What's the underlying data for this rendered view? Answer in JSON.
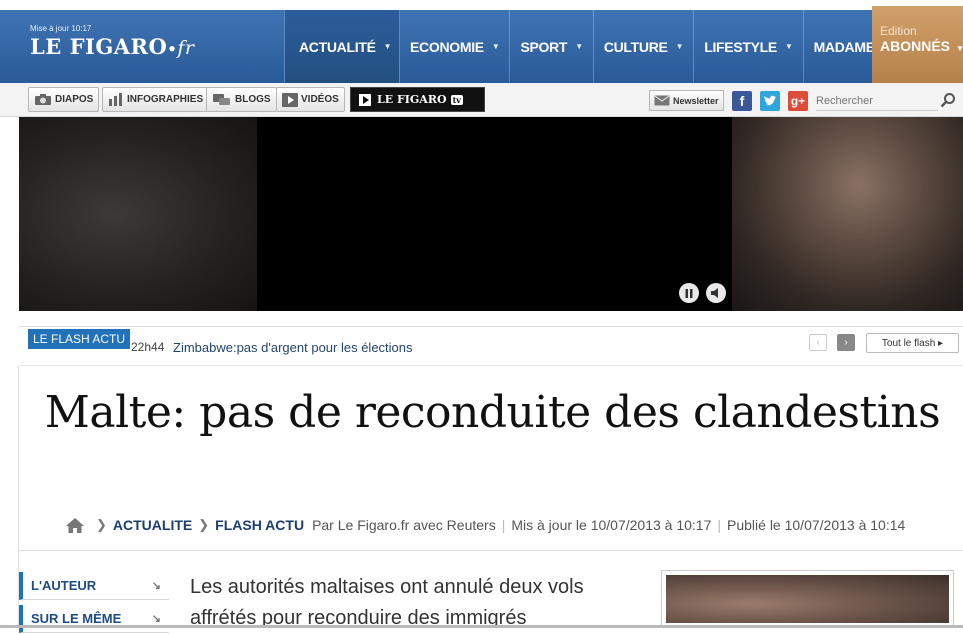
{
  "header": {
    "updated": "Mise à jour 10:17",
    "logo_main": "LE FIGARO",
    "logo_dot": "•",
    "logo_suffix": "fr",
    "nav": [
      {
        "label": "ACTUALITÉ"
      },
      {
        "label": "ECONOMIE"
      },
      {
        "label": "SPORT"
      },
      {
        "label": "CULTURE"
      },
      {
        "label": "LIFESTYLE"
      },
      {
        "label": "MADAME"
      }
    ],
    "edition": {
      "line1": "Edition",
      "line2": "ABONNÉS"
    }
  },
  "toolbar": {
    "diapos": "DIAPOS",
    "infographies": "INFOGRAPHIES",
    "blogs": "BLOGS",
    "videos": "VIDÉOS",
    "figaro_tv": "LE FIGARO",
    "tv_badge": "tv",
    "newsletter": "Newsletter",
    "search_placeholder": "Rechercher"
  },
  "flash": {
    "label": "LE FLASH ACTU",
    "time": "22h44",
    "text": "Zimbabwe:pas d'argent pour les élections",
    "all_link": "Tout le flash ▸"
  },
  "article": {
    "title": "Malte: pas de reconduite des clandestins",
    "breadcrumb": [
      "ACTUALITE",
      "FLASH ACTU"
    ],
    "author": "Par Le Figaro.fr avec Reuters",
    "updated": "Mis à jour le 10/07/2013 à 10:17",
    "published": "Publié le 10/07/2013 à 10:14",
    "lead": "Les autorités maltaises ont annulé deux vols affrétés pour reconduire des immigrés"
  },
  "sidebar": {
    "items": [
      {
        "label": "L'AUTEUR"
      },
      {
        "label": "SUR LE MÊME"
      }
    ]
  },
  "colors": {
    "header_blue": "#2f63a4",
    "abonnes_gold": "#c3925c",
    "flash_blue": "#2172b8",
    "link_navy": "#1d3f6e"
  }
}
